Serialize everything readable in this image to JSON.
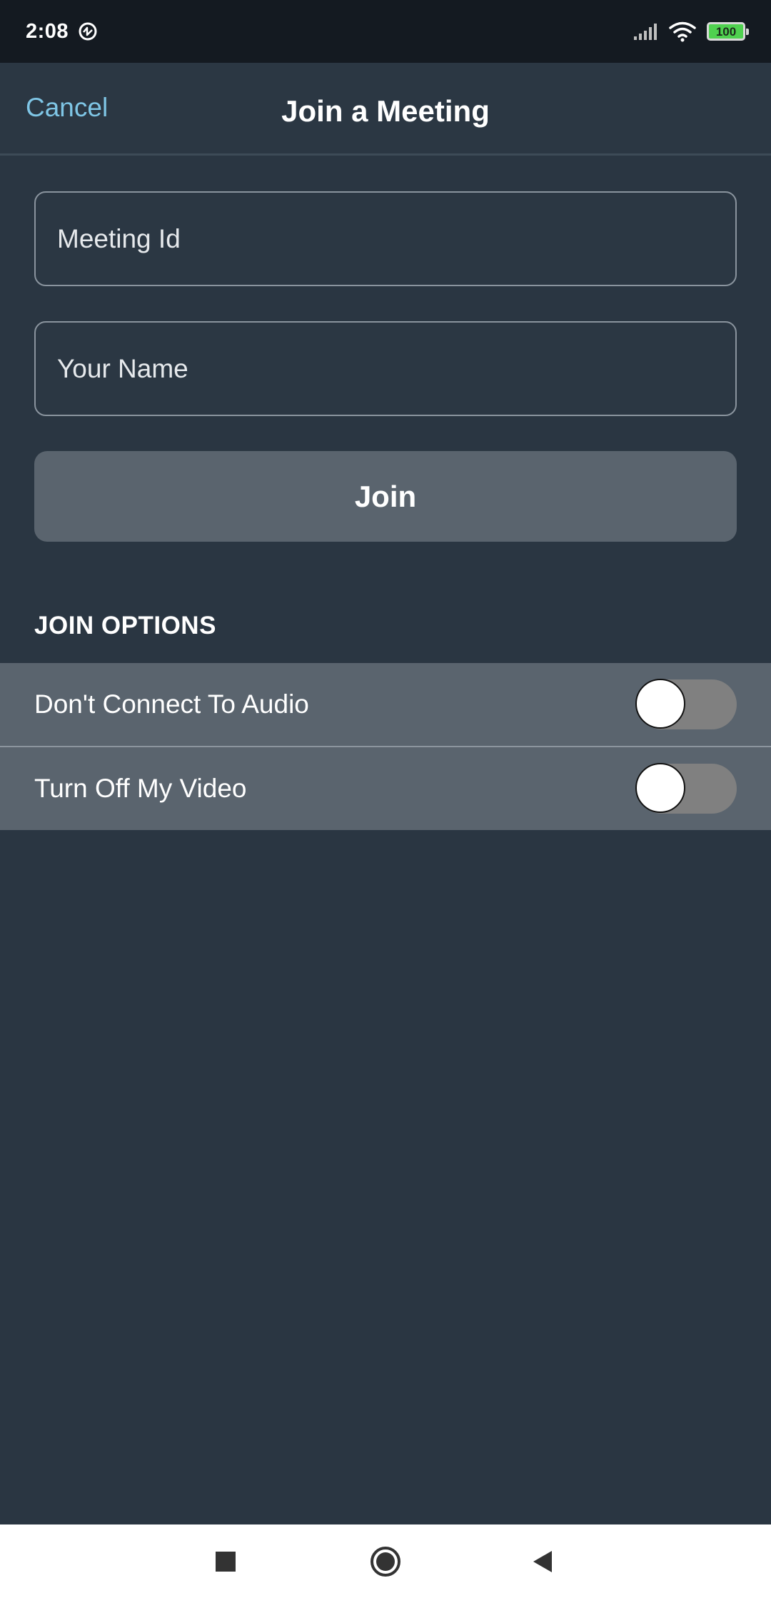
{
  "status_bar": {
    "time": "2:08",
    "battery_level": "100",
    "icons": [
      "sync-icon",
      "signal-icon",
      "wifi-icon",
      "battery-icon"
    ]
  },
  "header": {
    "cancel_label": "Cancel",
    "title": "Join a Meeting"
  },
  "form": {
    "meeting_id_placeholder": "Meeting Id",
    "meeting_id_value": "",
    "name_placeholder": "Your Name",
    "name_value": "",
    "join_label": "Join"
  },
  "join_options": {
    "heading": "JOIN OPTIONS",
    "items": [
      {
        "label": "Don't Connect To Audio",
        "enabled": false
      },
      {
        "label": "Turn Off My Video",
        "enabled": false
      }
    ]
  },
  "nav_bar": {
    "icons": [
      "recent-apps-icon",
      "home-icon",
      "back-icon"
    ]
  },
  "colors": {
    "background": "#2a3642",
    "accent_link": "#7fc6e6",
    "button": "#5a646e",
    "status_bar": "#141a21",
    "battery": "#4fd14f"
  }
}
